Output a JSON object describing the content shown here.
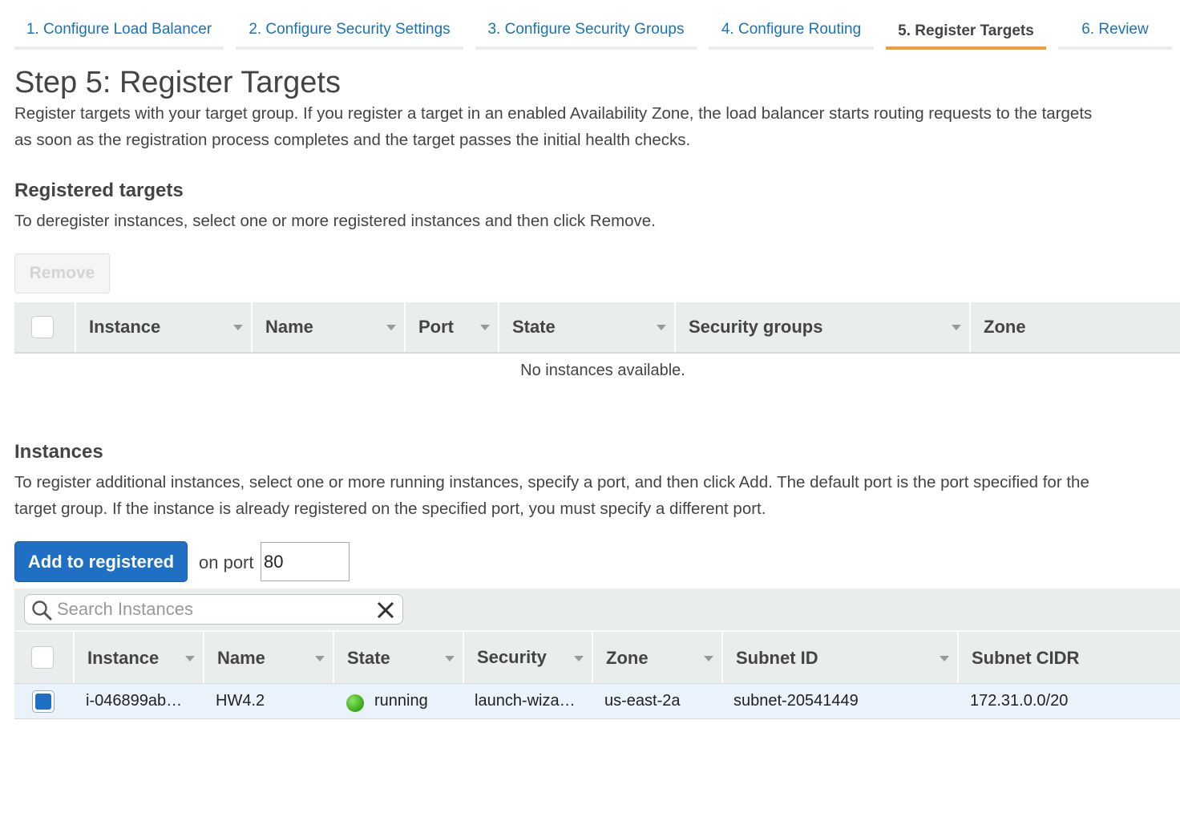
{
  "wizard": {
    "tabs": [
      {
        "label": "1. Configure Load Balancer"
      },
      {
        "label": "2. Configure Security Settings"
      },
      {
        "label": "3. Configure Security Groups"
      },
      {
        "label": "4. Configure Routing"
      },
      {
        "label": "5. Register Targets",
        "active": true
      },
      {
        "label": "6. Review"
      }
    ]
  },
  "page": {
    "title": "Step 5: Register Targets",
    "description_line1": "Register targets with your target group. If you register a target in an enabled Availability Zone, the load balancer starts routing requests to the targets",
    "description_line2": "as soon as the registration process completes and the target passes the initial health checks."
  },
  "registered": {
    "heading": "Registered targets",
    "help": "To deregister instances, select one or more registered instances and then click Remove.",
    "remove_label": "Remove",
    "columns": [
      "Instance",
      "Name",
      "Port",
      "State",
      "Security groups",
      "Zone"
    ],
    "empty_message": "No instances available."
  },
  "instances": {
    "heading": "Instances",
    "help_line1": "To register additional instances, select one or more running instances, specify a port, and then click Add. The default port is the port specified for the",
    "help_line2": "target group. If the instance is already registered on the specified port, you must specify a different port.",
    "add_label": "Add to registered",
    "on_port_label": "on port",
    "port_value": "80",
    "search_placeholder": "Search Instances",
    "columns": [
      "Instance",
      "Name",
      "State",
      "Security",
      "Zone",
      "Subnet ID",
      "Subnet CIDR"
    ],
    "rows": [
      {
        "selected": true,
        "instance": "i-046899ab…",
        "name": "HW4.2",
        "state": "running",
        "security": "launch-wiza…",
        "zone": "us-east-2a",
        "subnet_id": "subnet-20541449",
        "subnet_cidr": "172.31.0.0/20"
      }
    ]
  },
  "colors": {
    "link": "#1a73b5",
    "active_tab_underline": "#f39c3a",
    "primary_button": "#1f6fc4",
    "running_status": "#3fb21c",
    "selected_checkbox": "#1f6fc4"
  }
}
